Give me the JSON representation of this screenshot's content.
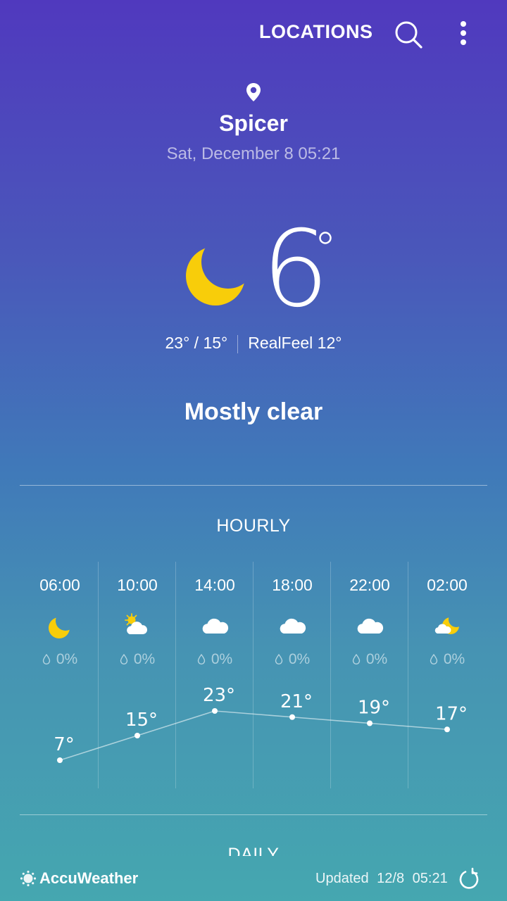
{
  "topbar": {
    "locations_label": "LOCATIONS",
    "search_icon": "search-icon",
    "menu_icon": "more-vert-icon"
  },
  "location": {
    "city": "Spicer",
    "datetime": "Sat, December 8 05:21",
    "pin_icon": "location-pin-icon"
  },
  "current": {
    "icon": "moon-icon",
    "temperature": "6",
    "high_low": "23° / 15°",
    "realfeel": "RealFeel 12°",
    "condition": "Mostly clear"
  },
  "hourly": {
    "title": "HOURLY",
    "items": [
      {
        "time": "06:00",
        "icon": "moon-icon",
        "precip": "0%",
        "temp": "7°"
      },
      {
        "time": "10:00",
        "icon": "partly-sunny-icon",
        "precip": "0%",
        "temp": "15°"
      },
      {
        "time": "14:00",
        "icon": "cloud-icon",
        "precip": "0%",
        "temp": "23°"
      },
      {
        "time": "18:00",
        "icon": "cloud-icon",
        "precip": "0%",
        "temp": "21°"
      },
      {
        "time": "22:00",
        "icon": "cloud-icon",
        "precip": "0%",
        "temp": "19°"
      },
      {
        "time": "02:00",
        "icon": "partly-cloudy-night-icon",
        "precip": "0%",
        "temp": "17°"
      }
    ]
  },
  "chart_data": {
    "type": "line",
    "x": [
      "06:00",
      "10:00",
      "14:00",
      "18:00",
      "22:00",
      "02:00"
    ],
    "series": [
      {
        "values": [
          7,
          15,
          23,
          21,
          19,
          17
        ]
      }
    ],
    "ylim": [
      7,
      23
    ]
  },
  "daily": {
    "title": "DAILY"
  },
  "footer": {
    "brand": "AccuWeather",
    "updated": "Updated 12/8 05:21",
    "refresh_icon": "refresh-icon"
  },
  "colors": {
    "moon": "#f8cd0a",
    "sun": "#f8cd0a",
    "cloud": "#ffffff"
  }
}
